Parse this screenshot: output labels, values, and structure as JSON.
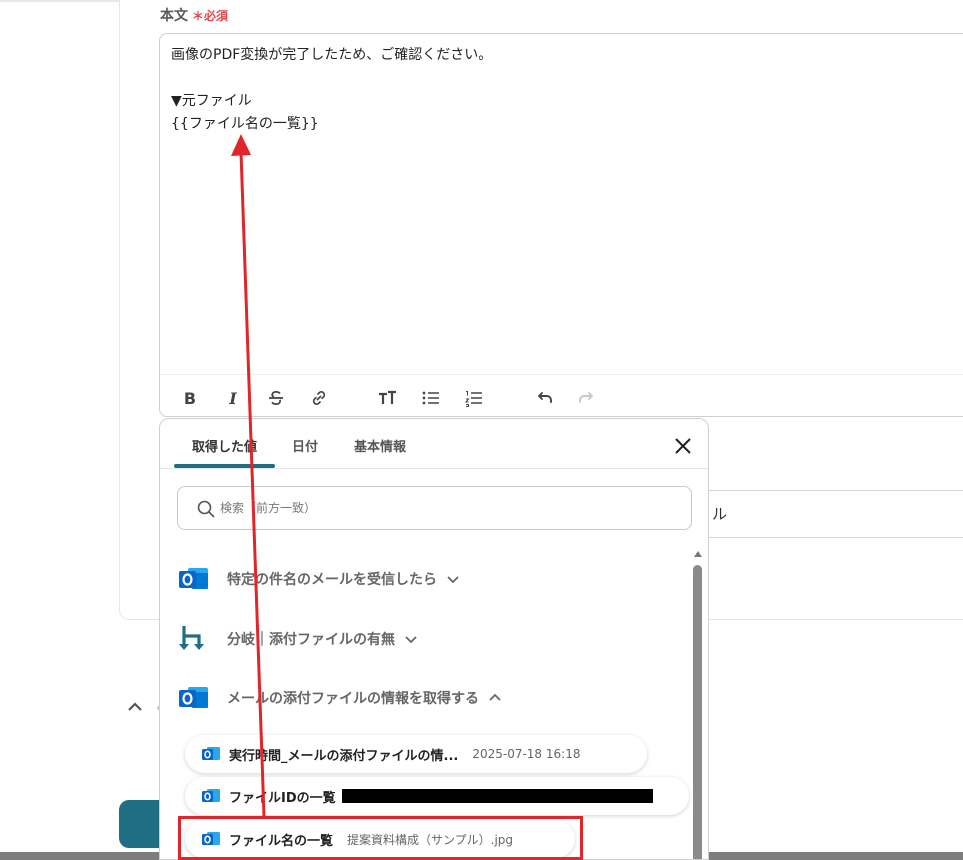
{
  "form": {
    "label": "本文",
    "required_mark": "＊",
    "required_text": "必須"
  },
  "editor": {
    "lines": [
      "画像のPDF変換が完了したため、ご確認ください。",
      "",
      "▼元ファイル",
      "{{ファイル名の一覧}}"
    ],
    "toolbar": {
      "bold": "B",
      "italic": "I"
    }
  },
  "background": {
    "field_text": "ル"
  },
  "popup": {
    "tabs": [
      {
        "label": "取得した値",
        "active": true
      },
      {
        "label": "日付",
        "active": false
      },
      {
        "label": "基本情報",
        "active": false
      }
    ],
    "search": {
      "placeholder": "検索（前方一致）"
    },
    "sections": [
      {
        "label": "特定の件名のメールを受信したら",
        "icon": "outlook-icon",
        "expanded": false
      },
      {
        "label": "分岐｜添付ファイルの有無",
        "icon": "branch-icon",
        "expanded": false
      },
      {
        "label": "メールの添付ファイルの情報を取得する",
        "icon": "outlook-icon",
        "expanded": true
      }
    ],
    "items": [
      {
        "key": "実行時間_メールの添付ファイルの情...",
        "value": "2025-07-18 16:18"
      },
      {
        "key": "ファイルIDの一覧",
        "value": ""
      },
      {
        "key": "ファイル名の一覧",
        "value": "提案資料構成（サンプル）.jpg"
      }
    ]
  },
  "colors": {
    "accent": "#1f6e83",
    "required": "#e5484d",
    "annotation": "#e0262a",
    "outlook_blue": "#0a64c9"
  }
}
